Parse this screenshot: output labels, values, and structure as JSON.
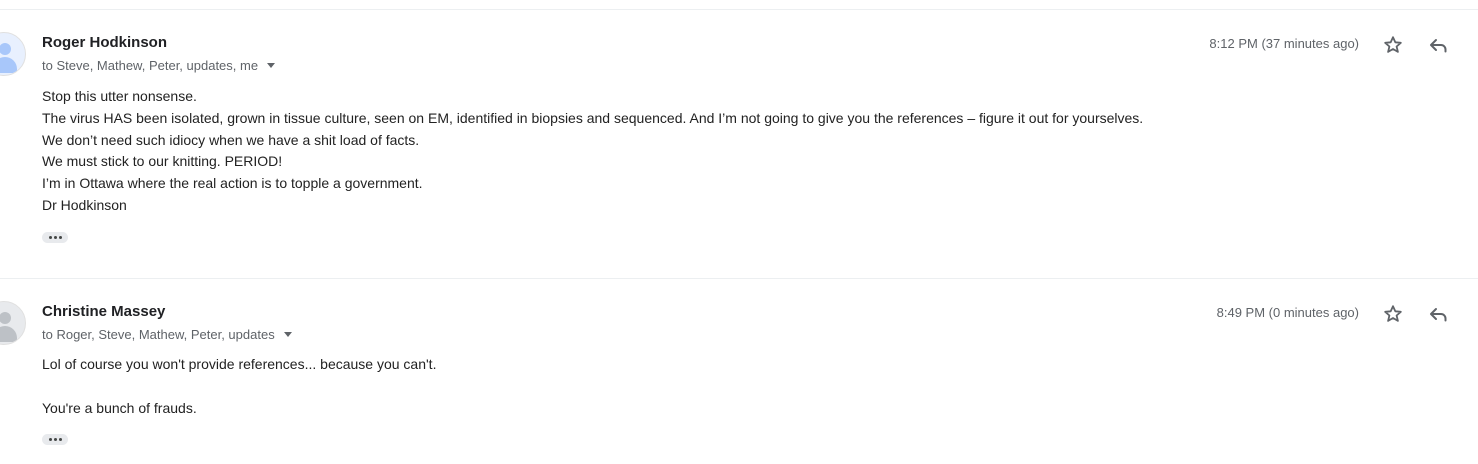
{
  "messages": [
    {
      "sender": "Roger Hodkinson",
      "recipients": "to Steve, Mathew, Peter, updates, me",
      "time": "8:12 PM (37 minutes ago)",
      "body": [
        "Stop this utter nonsense.",
        "The virus HAS been isolated, grown in tissue culture, seen on EM, identified in biopsies and sequenced. And I’m not going to give you the references – figure it out for yourselves.",
        "We don’t need such idiocy when we have a shit load of facts.",
        "We must stick to our knitting. PERIOD!",
        "I’m in Ottawa where the real action is to topple a government.",
        "Dr Hodkinson"
      ],
      "avatar_color": "#a8c7fa"
    },
    {
      "sender": "Christine Massey",
      "recipients": "to Roger, Steve, Mathew, Peter, updates",
      "time": "8:49 PM (0 minutes ago)",
      "body": [
        "Lol of course you won't provide references... because you can't.",
        "",
        "You're a bunch of frauds."
      ],
      "avatar_color": "#bdc1c6"
    }
  ],
  "icons": {
    "star": "star-outline-icon",
    "reply": "reply-arrow-icon",
    "more": "more-horiz-icon",
    "caret": "caret-down-icon"
  }
}
